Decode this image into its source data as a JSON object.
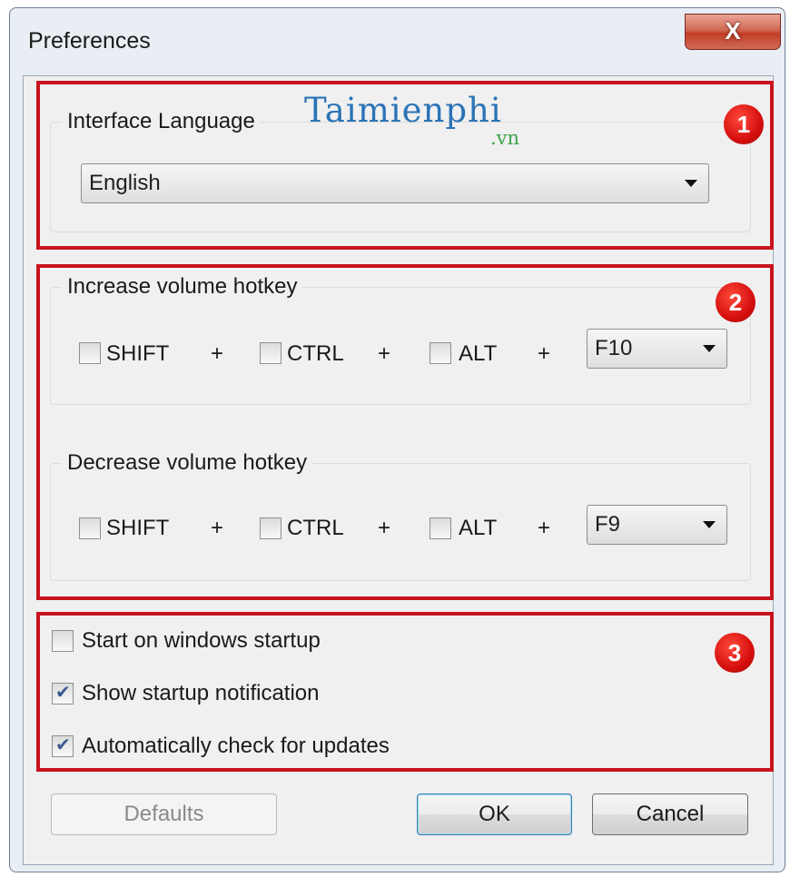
{
  "window": {
    "title": "Preferences",
    "close_label": "X"
  },
  "watermark": {
    "brand": "Taimienphi",
    "suffix": ".vn"
  },
  "badges": [
    "1",
    "2",
    "3"
  ],
  "language": {
    "legend": "Interface Language",
    "selected": "English"
  },
  "increase": {
    "legend": "Increase volume hotkey",
    "shift_label": "SHIFT",
    "ctrl_label": "CTRL",
    "alt_label": "ALT",
    "shift_checked": false,
    "ctrl_checked": false,
    "alt_checked": false,
    "key": "F10",
    "plus": "+"
  },
  "decrease": {
    "legend": "Decrease volume hotkey",
    "shift_label": "SHIFT",
    "ctrl_label": "CTRL",
    "alt_label": "ALT",
    "shift_checked": false,
    "ctrl_checked": false,
    "alt_checked": false,
    "key": "F9",
    "plus": "+"
  },
  "options": [
    {
      "label": "Start on windows startup",
      "checked": false
    },
    {
      "label": "Show startup notification",
      "checked": true
    },
    {
      "label": "Automatically check for updates",
      "checked": true
    }
  ],
  "buttons": {
    "defaults": "Defaults",
    "ok": "OK",
    "cancel": "Cancel"
  },
  "colors": {
    "highlight_border": "#c8131e",
    "badge": "#d50f0f",
    "close_button": "#c23f27"
  }
}
